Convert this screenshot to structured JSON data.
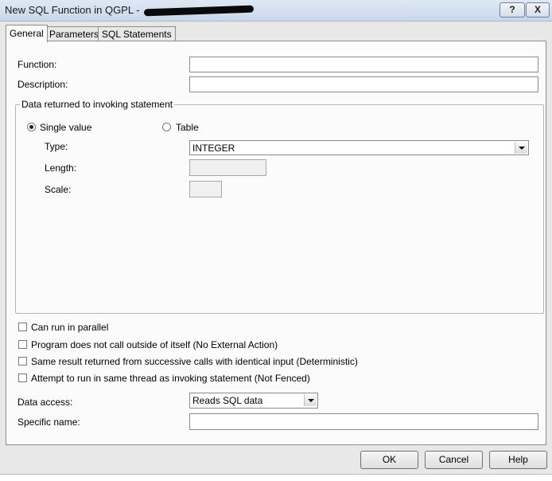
{
  "window": {
    "title": "New SQL Function in QGPL - ",
    "help_button": "?",
    "close_button": "X"
  },
  "tabs": [
    {
      "label": "General",
      "active": true
    },
    {
      "label": "Parameters",
      "active": false
    },
    {
      "label": "SQL Statements",
      "active": false
    }
  ],
  "general": {
    "function_label": "Function:",
    "function_value": "",
    "description_label": "Description:",
    "description_value": "",
    "group_title": "Data returned to invoking statement",
    "single_value_label": "Single value",
    "table_label": "Table",
    "selected_return": "single",
    "type_label": "Type:",
    "type_value": "INTEGER",
    "length_label": "Length:",
    "length_value": "",
    "scale_label": "Scale:",
    "scale_value": "",
    "checkboxes": [
      {
        "label": "Can run in parallel",
        "checked": false
      },
      {
        "label": "Program does not call outside of itself (No External Action)",
        "checked": false
      },
      {
        "label": "Same result returned from successive calls with identical input (Deterministic)",
        "checked": false
      },
      {
        "label": "Attempt to run in same thread as invoking statement (Not Fenced)",
        "checked": false
      }
    ],
    "data_access_label": "Data access:",
    "data_access_value": "Reads SQL data",
    "specific_name_label": "Specific name:",
    "specific_name_value": ""
  },
  "buttons": {
    "ok": "OK",
    "cancel": "Cancel",
    "help": "Help"
  }
}
